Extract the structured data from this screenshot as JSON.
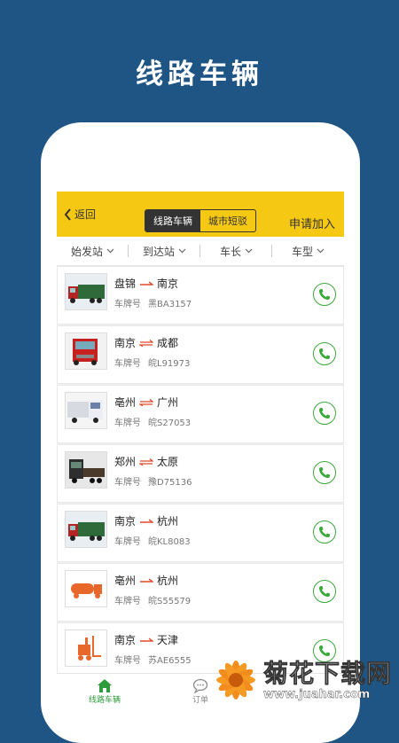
{
  "banner": {
    "title": "线路车辆"
  },
  "header": {
    "back_label": "返回",
    "segments": [
      "线路车辆",
      "城市短驳"
    ],
    "active_segment": 0,
    "apply_label": "申请加入"
  },
  "filters": [
    "始发站",
    "到达站",
    "车长",
    "车型"
  ],
  "plate_label": "车牌号",
  "vehicles": [
    {
      "from": "盘锦",
      "to": "南京",
      "direction": "oneway",
      "plate": "黑BA3157",
      "truck": "green-box"
    },
    {
      "from": "南京",
      "to": "成都",
      "direction": "twoway",
      "plate": "皖L91973",
      "truck": "red-cab"
    },
    {
      "from": "亳州",
      "to": "广州",
      "direction": "twoway",
      "plate": "皖S27053",
      "truck": "white-cab"
    },
    {
      "from": "郑州",
      "to": "太原",
      "direction": "twoway",
      "plate": "豫D75136",
      "truck": "dark-flatbed"
    },
    {
      "from": "南京",
      "to": "杭州",
      "direction": "oneway",
      "plate": "皖KL8083",
      "truck": "green-box"
    },
    {
      "from": "亳州",
      "to": "杭州",
      "direction": "oneway",
      "plate": "皖S55579",
      "truck": "tanker-icon"
    },
    {
      "from": "南京",
      "to": "天津",
      "direction": "oneway",
      "plate": "苏AE6555",
      "truck": "forklift-icon"
    }
  ],
  "tabs": [
    {
      "label": "线路车辆",
      "icon": "home-icon",
      "active": true
    },
    {
      "label": "订单",
      "icon": "chat-icon",
      "active": false
    }
  ],
  "watermark": {
    "name": "菊花下载网",
    "url": "www.juahar.com"
  },
  "colors": {
    "background": "#1f5585",
    "header": "#f5c813",
    "accent_green": "#3aa93a",
    "arrow_red": "#e04a2a"
  }
}
